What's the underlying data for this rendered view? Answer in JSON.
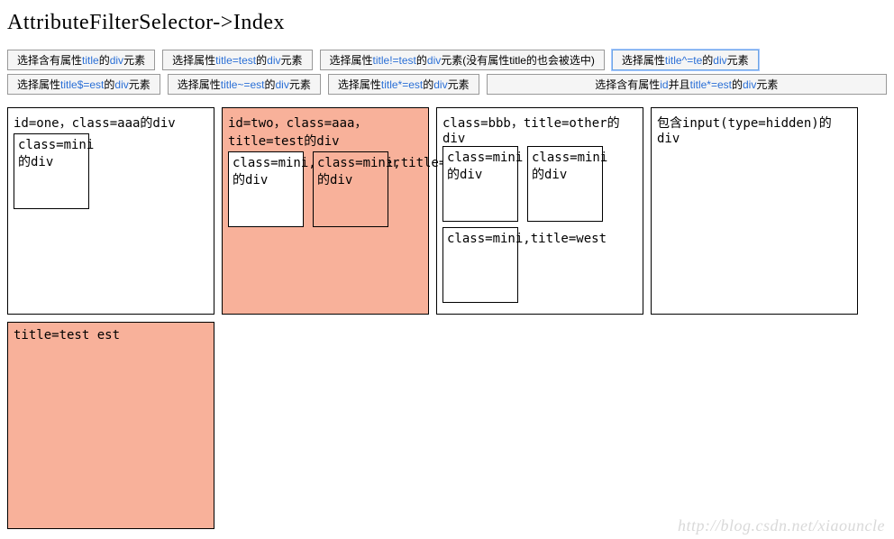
{
  "title": "AttributeFilterSelector->Index",
  "buttons_row1": [
    {
      "pre": "选择含有属性",
      "mid": "title",
      "post": "的",
      "tail": "元素"
    },
    {
      "pre": "选择属性",
      "mid": "title=test",
      "post": "的",
      "tail": "元素"
    },
    {
      "pre": "选择属性",
      "mid": "title!=test",
      "post": "的",
      "tail": "元素(没有属性title的也会被选中)"
    },
    {
      "pre": "选择属性",
      "mid": "title^=te",
      "post": "的",
      "tail": "元素",
      "focus": true
    }
  ],
  "buttons_row2": [
    {
      "pre": "选择属性",
      "mid": "title$=est",
      "post": "的",
      "tail": "元素"
    },
    {
      "pre": "选择属性",
      "mid": "title~=est",
      "post": "的",
      "tail": "元素"
    },
    {
      "pre": "选择属性",
      "mid": "title*=est",
      "post": "的",
      "tail": "元素"
    },
    {
      "pre": "选择含有属性",
      "mid": "id",
      "post": "并且",
      "mid2": "title*=est",
      "post2": "的",
      "tail": "元素",
      "wide": true
    }
  ],
  "boxes": {
    "one": {
      "label": "id=one，class=aaa的div",
      "mini": [
        {
          "text": "class=mini的div"
        }
      ]
    },
    "two": {
      "label": "id=two，class=aaa，title=test的div",
      "selected": true,
      "mini": [
        {
          "text": "class=mini,title=other的div"
        },
        {
          "text": "class=mini,title=test的div",
          "selected": true
        }
      ]
    },
    "three": {
      "label": "class=bbb，title=other的div",
      "mini_col1": [
        {
          "text": "class=mini的div"
        },
        {
          "text": "class=mini,title=west"
        }
      ],
      "mini_col2": [
        {
          "text": "class=mini的div"
        }
      ]
    },
    "four": {
      "label": "包含input(type=hidden)的div"
    },
    "five": {
      "label": "title=test est",
      "selected": true
    }
  },
  "watermark": "http://blog.csdn.net/xiaouncle"
}
